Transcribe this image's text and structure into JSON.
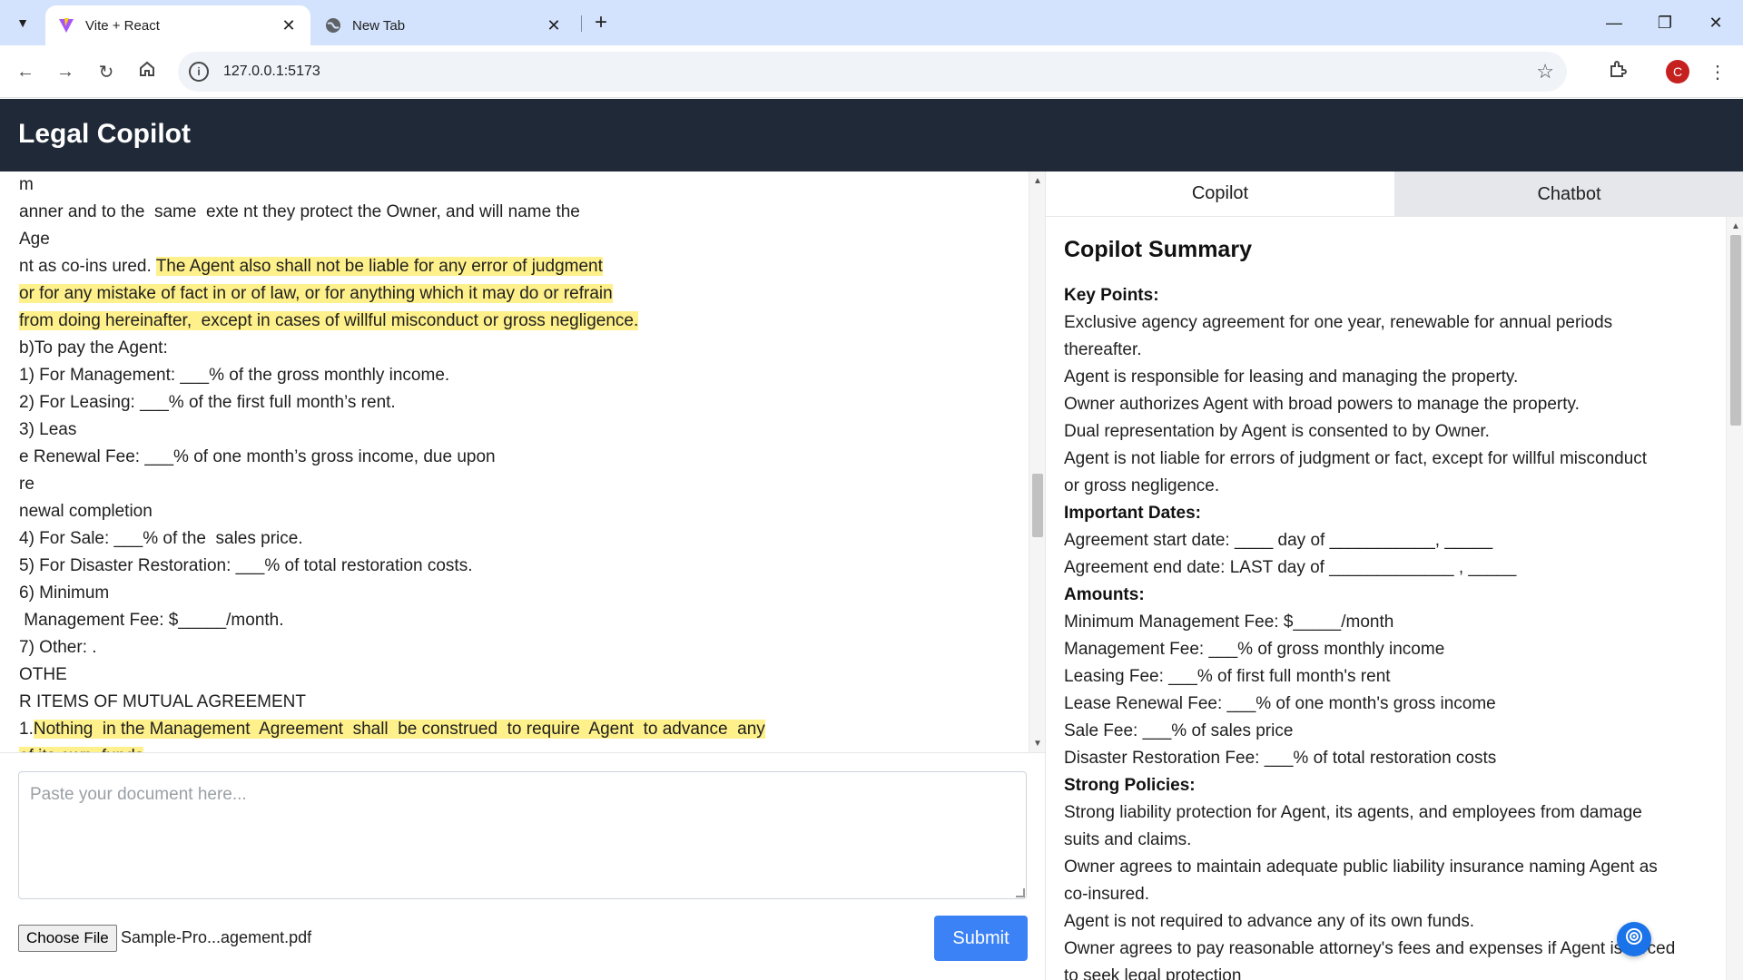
{
  "browser": {
    "tabs": [
      {
        "title": "Vite + React",
        "icon": "vite-icon",
        "active": true
      },
      {
        "title": "New Tab",
        "icon": "globe-icon",
        "active": false
      }
    ],
    "address": "127.0.0.1:5173",
    "profile_initial": "C"
  },
  "app": {
    "title": "Legal Copilot"
  },
  "document": {
    "lines": [
      [
        {
          "t": "m",
          "h": false
        }
      ],
      [
        {
          "t": "anner and to the  same  exte nt they protect the Owner, and will name the",
          "h": false
        }
      ],
      [
        {
          "t": "Age",
          "h": false
        }
      ],
      [
        {
          "t": "nt as co-ins ured. ",
          "h": false
        },
        {
          "t": "The Agent also shall not be liable for any error of judgment",
          "h": true
        }
      ],
      [
        {
          "t": "or for any mistake of fact in or of law, or for anything which it may do or refrain",
          "h": true
        }
      ],
      [
        {
          "t": "from doing hereinafter,  except in cases of willful misconduct or gross negligence.",
          "h": true
        }
      ],
      [
        {
          "t": "b)To pay the Agent:",
          "h": false
        }
      ],
      [
        {
          "t": "1) For Management: ___% of the gross monthly income.",
          "h": false
        }
      ],
      [
        {
          "t": "2) For Leasing: ___% of the first full month’s rent.",
          "h": false
        }
      ],
      [
        {
          "t": "3) Leas",
          "h": false
        }
      ],
      [
        {
          "t": "e Renewal Fee: ___% of one month’s gross income, due upon",
          "h": false
        }
      ],
      [
        {
          "t": "re",
          "h": false
        }
      ],
      [
        {
          "t": "newal completion",
          "h": false
        }
      ],
      [
        {
          "t": "4) For Sale: ___% of the  sales price.",
          "h": false
        }
      ],
      [
        {
          "t": "5) For Disaster Restoration: ___% of total restoration costs.",
          "h": false
        }
      ],
      [
        {
          "t": "6) Minimum",
          "h": false
        }
      ],
      [
        {
          "t": " Management Fee: $_____/month.",
          "h": false
        }
      ],
      [
        {
          "t": "7) Other: .",
          "h": false
        }
      ],
      [
        {
          "t": "OTHE",
          "h": false
        }
      ],
      [
        {
          "t": "R ITEMS OF MUTUAL AGREEMENT",
          "h": false
        }
      ],
      [
        {
          "t": "1.",
          "h": false
        },
        {
          "t": "Nothing  in the Management  Agreement  shall  be construed  to require  Agent  to advance  any",
          "h": true
        }
      ],
      [
        {
          "t": "of its own  funds",
          "h": true
        }
      ]
    ],
    "scroll_fraction": 0.52
  },
  "input": {
    "placeholder": "Paste your document here...",
    "value": "",
    "choose_file_label": "Choose File",
    "file_name": "Sample-Pro...agement.pdf",
    "submit_label": "Submit"
  },
  "panel": {
    "tabs": [
      "Copilot",
      "Chatbot"
    ],
    "active_tab": "Copilot",
    "summary_title": "Copilot Summary",
    "summary_lines": [
      {
        "t": "Key Points:",
        "bold": true
      },
      {
        "t": "Exclusive agency agreement for one year, renewable for annual periods",
        "bold": false
      },
      {
        "t": "thereafter.",
        "bold": false
      },
      {
        "t": "Agent is responsible for leasing and managing the property.",
        "bold": false
      },
      {
        "t": "Owner authorizes Agent with broad powers to manage the property.",
        "bold": false
      },
      {
        "t": "Dual representation by Agent is consented to by Owner.",
        "bold": false
      },
      {
        "t": "Agent is not liable for errors of judgment or fact, except for willful misconduct",
        "bold": false
      },
      {
        "t": "or gross negligence.",
        "bold": false
      },
      {
        "t": "Important Dates:",
        "bold": true
      },
      {
        "t": "Agreement start date: ____ day of ___________, _____",
        "bold": false
      },
      {
        "t": "Agreement end date: LAST day of _____________ , _____",
        "bold": false
      },
      {
        "t": "Amounts:",
        "bold": true
      },
      {
        "t": "Minimum Management Fee: $_____/month",
        "bold": false
      },
      {
        "t": "Management Fee: ___% of gross monthly income",
        "bold": false
      },
      {
        "t": "Leasing Fee: ___% of first full month's rent",
        "bold": false
      },
      {
        "t": "Lease Renewal Fee: ___% of one month's gross income",
        "bold": false
      },
      {
        "t": "Sale Fee: ___% of sales price",
        "bold": false
      },
      {
        "t": "Disaster Restoration Fee: ___% of total restoration costs",
        "bold": false
      },
      {
        "t": "Strong Policies:",
        "bold": true
      },
      {
        "t": "Strong liability protection for Agent, its agents, and employees from damage",
        "bold": false
      },
      {
        "t": "suits and claims.",
        "bold": false
      },
      {
        "t": "Owner agrees to maintain adequate public liability insurance naming Agent as",
        "bold": false
      },
      {
        "t": "co-insured.",
        "bold": false
      },
      {
        "t": "Agent is not required to advance any of its own funds.",
        "bold": false
      },
      {
        "t": "Owner agrees to pay reasonable attorney's fees and expenses if Agent is forced",
        "bold": false
      },
      {
        "t": "to seek legal protection",
        "bold": false
      }
    ]
  },
  "colors": {
    "header_bg": "#1f2937",
    "highlight": "#fef08a",
    "submit_bg": "#3b82f6",
    "tab_inactive_bg": "#e5e7eb"
  }
}
